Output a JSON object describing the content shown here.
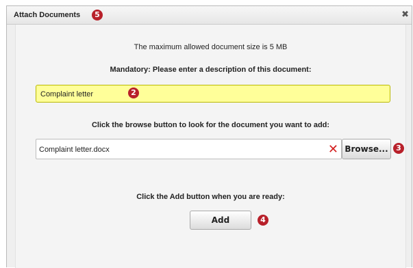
{
  "dialog": {
    "title": "Attach Documents",
    "close_symbol": "✖"
  },
  "badges": {
    "title_step": "5",
    "description_step": "2",
    "browse_step": "3",
    "add_step": "4"
  },
  "content": {
    "max_size_text": "The maximum allowed document size is 5 MB",
    "description_label": "Mandatory: Please enter a description of this document:",
    "description_value": "Complaint letter",
    "browse_label": "Click the browse button to look for the document you want to add:",
    "file_value": "Complaint letter.docx",
    "clear_symbol": "✕",
    "browse_button": "Browse...",
    "add_label": "Click the Add button when you are ready:",
    "add_button": "Add"
  },
  "colors": {
    "badge": "#b8202a",
    "mandatory_field": "#ffff99",
    "clear_icon": "#d32020"
  }
}
